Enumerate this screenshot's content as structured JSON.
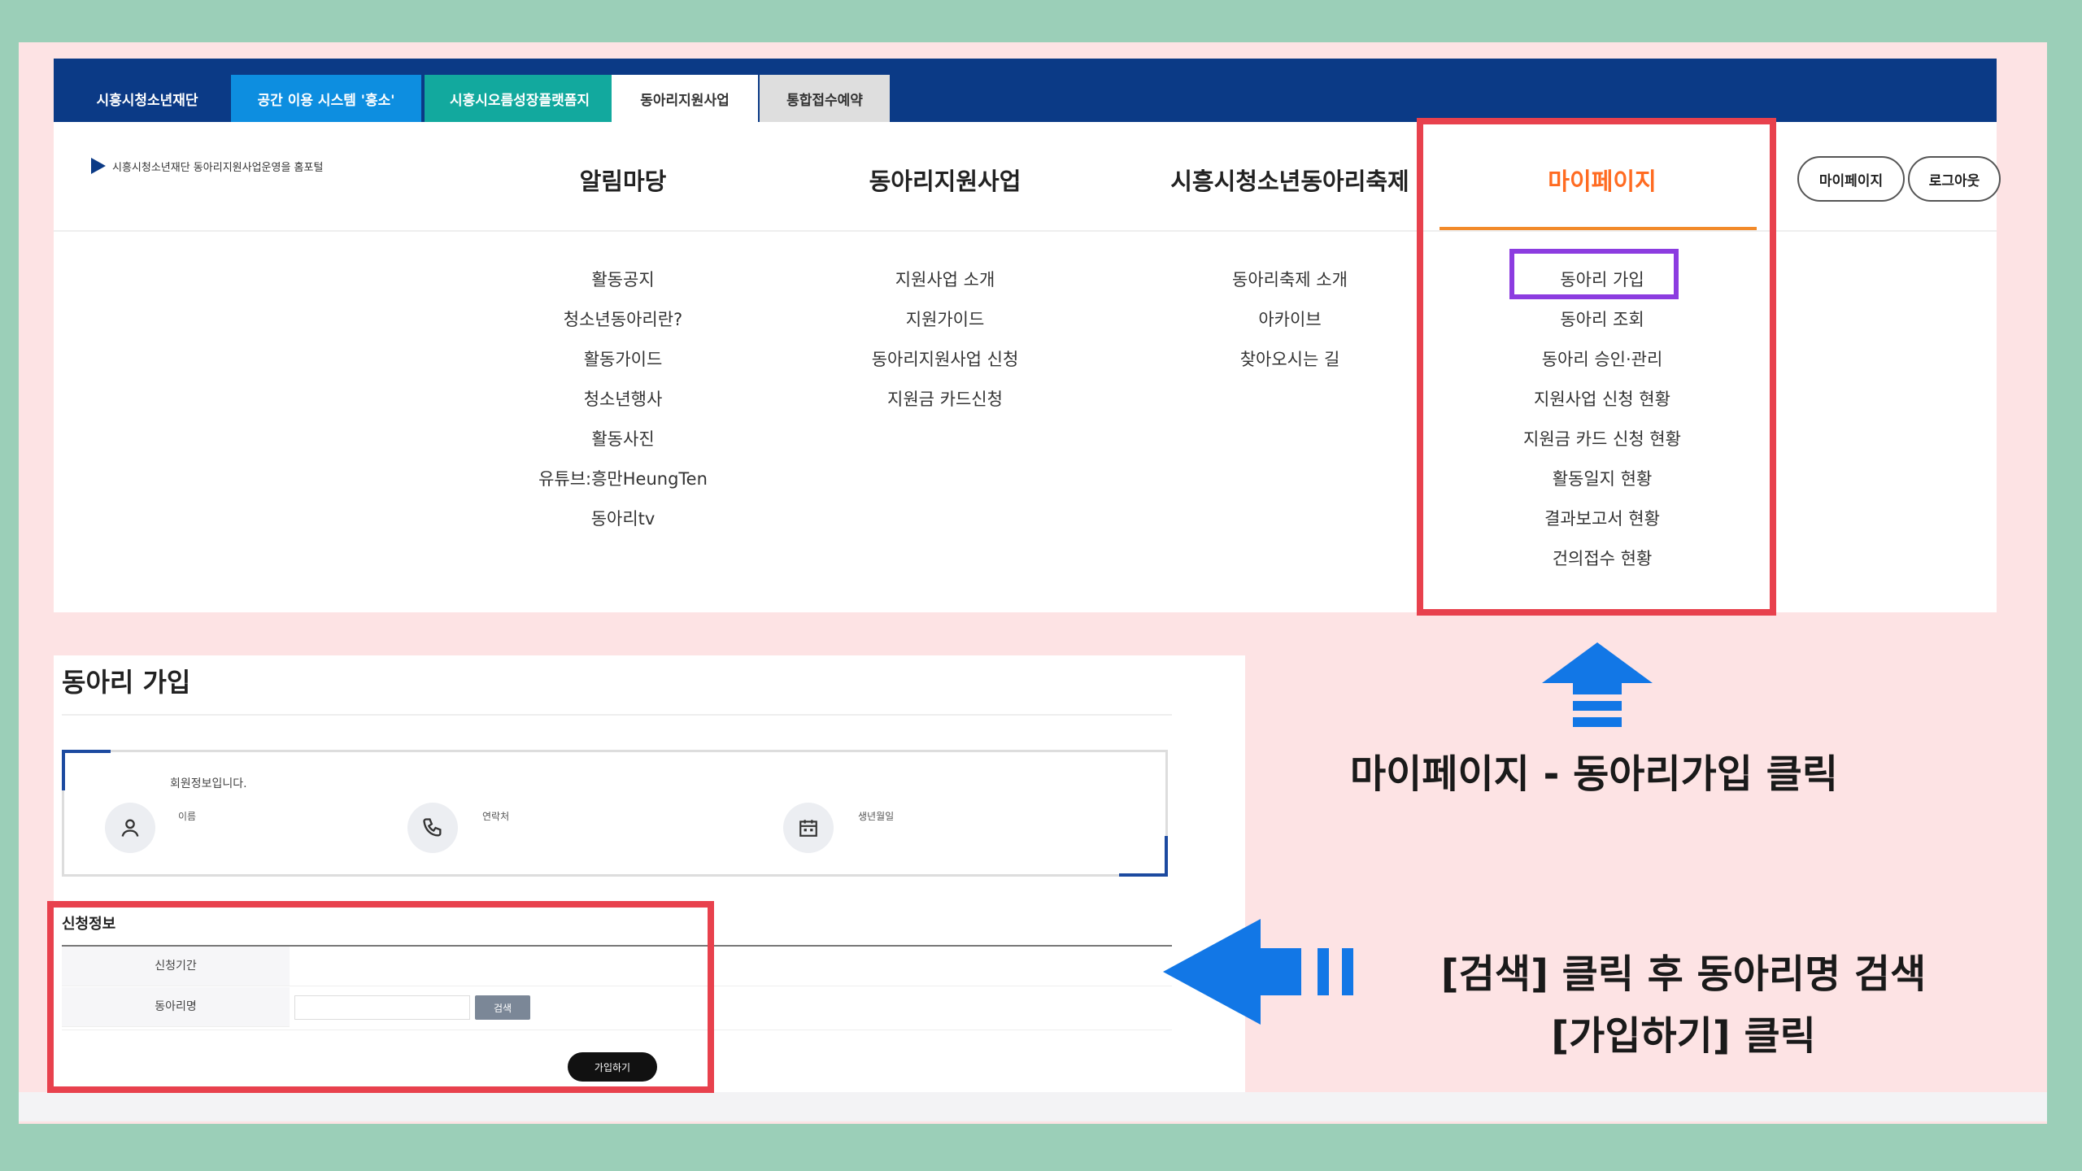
{
  "topbar": {
    "tabs": [
      "시흥시청소년재단",
      "공간 이용 시스템 '흥소'",
      "시흥시오름성장플랫폼지",
      "동아리지원사업",
      "통합접수예약"
    ]
  },
  "logo": {
    "text": "시흥시청소년재단 동아리지원사업운영을 홈포털"
  },
  "nav": {
    "items": [
      "알림마당",
      "동아리지원사업",
      "시흥시청소년동아리축제",
      "마이페이지"
    ],
    "buttons": {
      "mypage": "마이페이지",
      "logout": "로그아웃"
    }
  },
  "submenus": {
    "col1": [
      "활동공지",
      "청소년동아리란?",
      "활동가이드",
      "청소년행사",
      "활동사진",
      "유튜브:흥만HeungTen",
      "동아리tv"
    ],
    "col2": [
      "지원사업 소개",
      "지원가이드",
      "동아리지원사업 신청",
      "지원금 카드신청"
    ],
    "col3": [
      "동아리축제 소개",
      "아카이브",
      "찾아오시는 길"
    ],
    "col4": [
      "동아리 가입",
      "동아리 조회",
      "동아리 승인·관리",
      "지원사업 신청 현황",
      "지원금 카드 신청 현황",
      "활동일지 현황",
      "결과보고서 현황",
      "건의접수 현황"
    ]
  },
  "form": {
    "title": "동아리 가입",
    "info_caption": "회원정보입니다.",
    "labels": {
      "name": "이름",
      "phone": "연락처",
      "birth": "생년월일"
    },
    "apply_title": "신청정보",
    "rows": [
      "신청기간",
      "동아리명"
    ],
    "search_label": "검색",
    "join_label": "가입하기"
  },
  "annotations": {
    "caption1": "마이페이지 - 동아리가입 클릭",
    "caption2_line1": "[검색] 클릭 후 동아리명 검색",
    "caption2_line2": "[가입하기] 클릭"
  },
  "colors": {
    "topbar": "#0b3a86",
    "accent_orange": "#ff6b21",
    "highlight_red": "#e8414d",
    "highlight_purple": "#8c3ce0",
    "arrow_blue": "#1277e6",
    "slide_pink": "#fde3e4",
    "frame_green": "#9bcfb8"
  }
}
